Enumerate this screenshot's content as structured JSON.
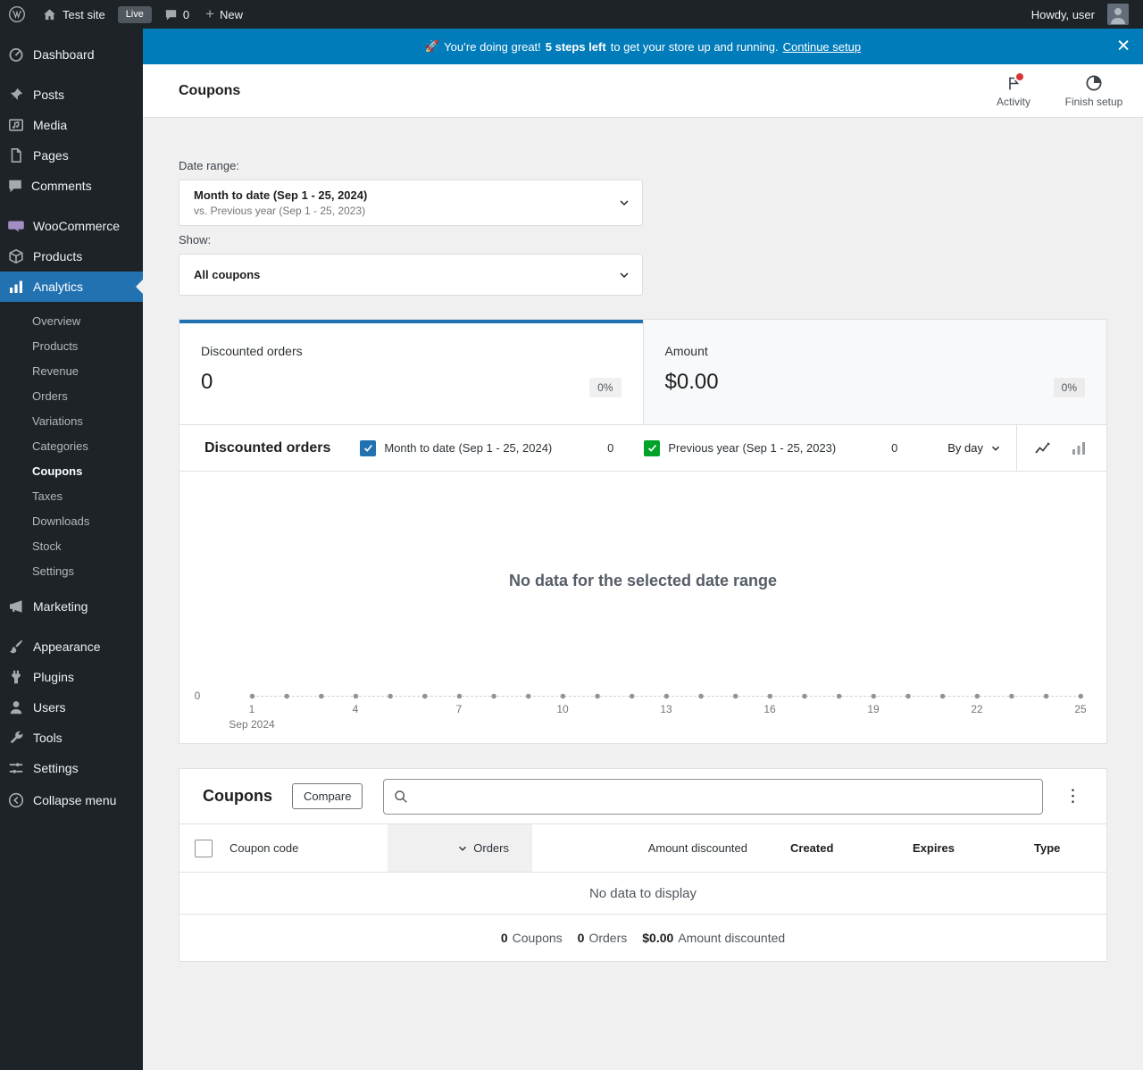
{
  "colors": {
    "banner": "#007cba",
    "accent": "#2271b1",
    "notification": "#d63638",
    "series_primary": "#2271b1",
    "series_secondary": "#00a32a"
  },
  "icons": {
    "plus": "+",
    "close": "✕",
    "ellipsis": "⋮"
  },
  "admin_bar": {
    "site_name": "Test site",
    "live_badge": "Live",
    "comment_count": "0",
    "new_label": "New",
    "howdy_text": "Howdy, user"
  },
  "sidebar": {
    "items": [
      {
        "label": "Dashboard"
      },
      {
        "label": "Posts"
      },
      {
        "label": "Media"
      },
      {
        "label": "Pages"
      },
      {
        "label": "Comments"
      },
      {
        "label": "WooCommerce"
      },
      {
        "label": "Products"
      },
      {
        "label": "Analytics"
      },
      {
        "label": "Marketing"
      },
      {
        "label": "Appearance"
      },
      {
        "label": "Plugins"
      },
      {
        "label": "Users"
      },
      {
        "label": "Tools"
      },
      {
        "label": "Settings"
      },
      {
        "label": "Collapse menu"
      }
    ],
    "active_item": "Analytics",
    "analytics_submenu": [
      "Overview",
      "Products",
      "Revenue",
      "Orders",
      "Variations",
      "Categories",
      "Coupons",
      "Taxes",
      "Downloads",
      "Stock",
      "Settings"
    ],
    "active_subitem": "Coupons"
  },
  "banner": {
    "emoji": "🚀",
    "message": "You’re doing great!",
    "steps_left": "5 steps left",
    "message_2": "to get your store up and running.",
    "cta": "Continue setup"
  },
  "page_header": {
    "title": "Coupons",
    "activity_label": "Activity",
    "finish_setup_label": "Finish setup"
  },
  "filters": {
    "date_range_label": "Date range:",
    "date_range_primary": "Month to date (Sep 1 - 25, 2024)",
    "date_range_secondary": "vs. Previous year (Sep 1 - 25, 2023)",
    "show_label": "Show:",
    "show_value": "All coupons"
  },
  "summary_tiles": [
    {
      "label": "Discounted orders",
      "value": "0",
      "delta": "0%",
      "selected": true
    },
    {
      "label": "Amount",
      "value": "$0.00",
      "delta": "0%",
      "selected": false
    }
  ],
  "chart": {
    "type": "line",
    "title": "Discounted orders",
    "series": [
      {
        "label": "Month to date (Sep 1 - 25, 2024)",
        "value": "0",
        "color": "#2271b1",
        "checked": true
      },
      {
        "label": "Previous year (Sep 1 - 25, 2023)",
        "value": "0",
        "color": "#00a32a",
        "checked": true
      }
    ],
    "interval_value": "By day",
    "empty_message": "No data for the selected date range",
    "y_ticks": [
      "0"
    ],
    "x_ticks": [
      "1",
      "4",
      "7",
      "10",
      "13",
      "16",
      "19",
      "22",
      "25"
    ],
    "x_axis_sublabel": "Sep 2024"
  },
  "coupons_panel": {
    "title": "Coupons",
    "compare_label": "Compare",
    "search_placeholder": "",
    "search_value": "",
    "columns": [
      {
        "label": "Coupon code",
        "sorted": false
      },
      {
        "label": "Orders",
        "sorted": true
      },
      {
        "label": "Amount discounted",
        "sorted": false
      },
      {
        "label": "Created",
        "sorted": false
      },
      {
        "label": "Expires",
        "sorted": false
      },
      {
        "label": "Type",
        "sorted": false
      }
    ],
    "empty_message": "No data to display",
    "totals": [
      {
        "value": "0",
        "label": "Coupons"
      },
      {
        "value": "0",
        "label": "Orders"
      },
      {
        "value": "$0.00",
        "label": "Amount discounted"
      }
    ]
  }
}
